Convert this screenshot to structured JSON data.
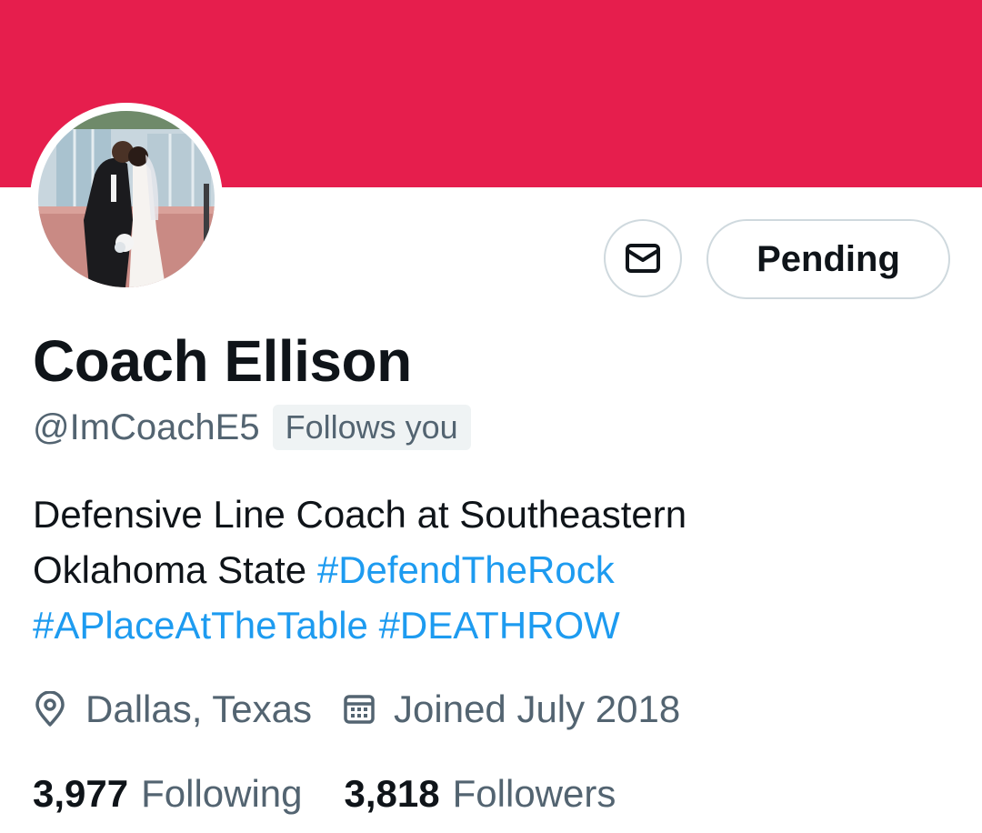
{
  "profile": {
    "name": "Coach Ellison",
    "handle": "@ImCoachE5",
    "follows_you_badge": "Follows you",
    "bio": {
      "line1": "Defensive Line Coach at Southeastern",
      "line2_text": "Oklahoma State",
      "line2_hashtag": "#DefendTheRock",
      "line3_hashtag1": "#APlaceAtTheTable",
      "line3_hashtag2": "#DEATHROW"
    },
    "location": "Dallas, Texas",
    "joined": "Joined July 2018",
    "stats": {
      "following_count": "3,977",
      "following_label": "Following",
      "followers_count": "3,818",
      "followers_label": "Followers"
    }
  },
  "actions": {
    "pending_label": "Pending",
    "message_icon": "envelope-icon"
  },
  "icons": {
    "location": "location-pin-icon",
    "joined": "calendar-icon"
  },
  "colors": {
    "banner": "#e61e4d",
    "text_primary": "#0f1419",
    "text_secondary": "#536471",
    "link": "#1d9bf0",
    "border": "#cfd9de",
    "badge_bg": "#eff3f4"
  }
}
